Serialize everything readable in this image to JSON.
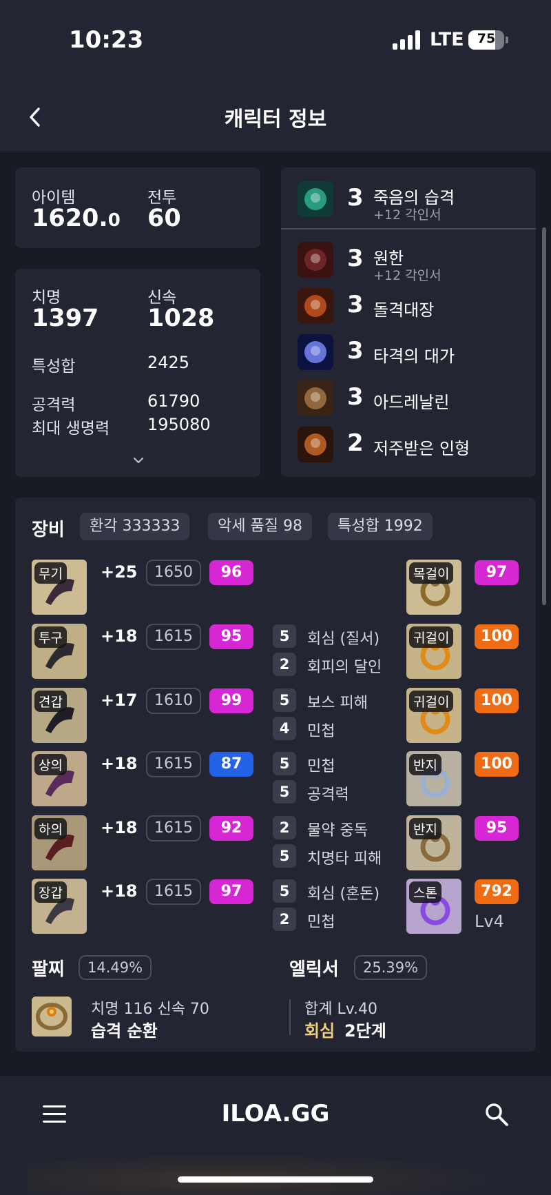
{
  "status": {
    "time": "10:23",
    "network": "LTE",
    "battery": "75",
    "battery_level": 0.75
  },
  "header": {
    "title": "캐릭터 정보"
  },
  "summary": {
    "item_label": "아이템",
    "item_main": "1620.",
    "item_dec": "0",
    "combat_label": "전투",
    "combat_value": "60"
  },
  "stats": {
    "crit_label": "치명",
    "crit_value": "1397",
    "swift_label": "신속",
    "swift_value": "1028",
    "trait_label": "특성합",
    "trait_value": "2425",
    "attack_label": "공격력",
    "attack_value": "61790",
    "hp_label": "최대 생명력",
    "hp_value": "195080"
  },
  "engravings": [
    {
      "level": "3",
      "name": "죽음의 습격",
      "sub": "+12 각인서",
      "icon": "death-strike-icon"
    },
    {
      "level": "3",
      "name": "원한",
      "sub": "+12 각인서",
      "icon": "grudge-icon"
    },
    {
      "level": "3",
      "name": "돌격대장",
      "sub": "",
      "icon": "raid-captain-icon"
    },
    {
      "level": "3",
      "name": "타격의 대가",
      "sub": "",
      "icon": "hit-master-icon"
    },
    {
      "level": "3",
      "name": "아드레날린",
      "sub": "",
      "icon": "adrenaline-icon"
    },
    {
      "level": "2",
      "name": "저주받은 인형",
      "sub": "",
      "icon": "cursed-doll-icon"
    }
  ],
  "equipment": {
    "title": "장비",
    "pills": [
      "환각 333333",
      "악세 품질 98",
      "특성합 1992"
    ],
    "armor": [
      {
        "tag": "무기",
        "plus": "+25",
        "ilvl": "1650",
        "quality": "96",
        "q_color": "pink",
        "icon": "weapon-icon"
      },
      {
        "tag": "투구",
        "plus": "+18",
        "ilvl": "1615",
        "quality": "95",
        "q_color": "pink",
        "icon": "helmet-icon"
      },
      {
        "tag": "견갑",
        "plus": "+17",
        "ilvl": "1610",
        "quality": "99",
        "q_color": "pink",
        "icon": "shoulder-icon"
      },
      {
        "tag": "상의",
        "plus": "+18",
        "ilvl": "1615",
        "quality": "87",
        "q_color": "blue",
        "icon": "chest-icon"
      },
      {
        "tag": "하의",
        "plus": "+18",
        "ilvl": "1615",
        "quality": "92",
        "q_color": "pink",
        "icon": "pants-icon"
      },
      {
        "tag": "장갑",
        "plus": "+18",
        "ilvl": "1615",
        "quality": "97",
        "q_color": "pink",
        "icon": "gloves-icon"
      }
    ],
    "effects": [
      [],
      [
        {
          "n": "5",
          "t": "회심 (질서)"
        },
        {
          "n": "2",
          "t": "회피의 달인"
        }
      ],
      [
        {
          "n": "5",
          "t": "보스 피해"
        },
        {
          "n": "4",
          "t": "민첩"
        }
      ],
      [
        {
          "n": "5",
          "t": "민첩"
        },
        {
          "n": "5",
          "t": "공격력"
        }
      ],
      [
        {
          "n": "2",
          "t": "물약 중독"
        },
        {
          "n": "5",
          "t": "치명타 피해"
        }
      ],
      [
        {
          "n": "5",
          "t": "회심 (혼돈)"
        },
        {
          "n": "2",
          "t": "민첩"
        }
      ]
    ],
    "accessories": [
      {
        "tag": "목걸이",
        "quality": "97",
        "q_color": "pink",
        "icon": "necklace-icon"
      },
      {
        "tag": "귀걸이",
        "quality": "100",
        "q_color": "orange",
        "icon": "earring-icon"
      },
      {
        "tag": "귀걸이",
        "quality": "100",
        "q_color": "orange",
        "icon": "earring-icon"
      },
      {
        "tag": "반지",
        "quality": "100",
        "q_color": "orange",
        "icon": "ring-icon"
      },
      {
        "tag": "반지",
        "quality": "95",
        "q_color": "pink",
        "icon": "ring-icon"
      },
      {
        "tag": "스톤",
        "quality": "792",
        "q_color": "orange",
        "icon": "stone-icon",
        "extra": "Lv4"
      }
    ]
  },
  "bracelet": {
    "title": "팔찌",
    "pct": "14.49%",
    "line1": "치명 116  신속 70",
    "line2": "습격  순환"
  },
  "elixir": {
    "title": "엘릭서",
    "pct": "25.39%",
    "line1": "합계 Lv.40",
    "line2_a": "회심",
    "line2_b": "2단계"
  },
  "bottom": {
    "logo": "ILOA.GG"
  },
  "colors": {
    "bg": "#181b24",
    "card": "#232632",
    "pink": "#d727d4",
    "blue": "#2463e8",
    "orange": "#ef6c14"
  }
}
